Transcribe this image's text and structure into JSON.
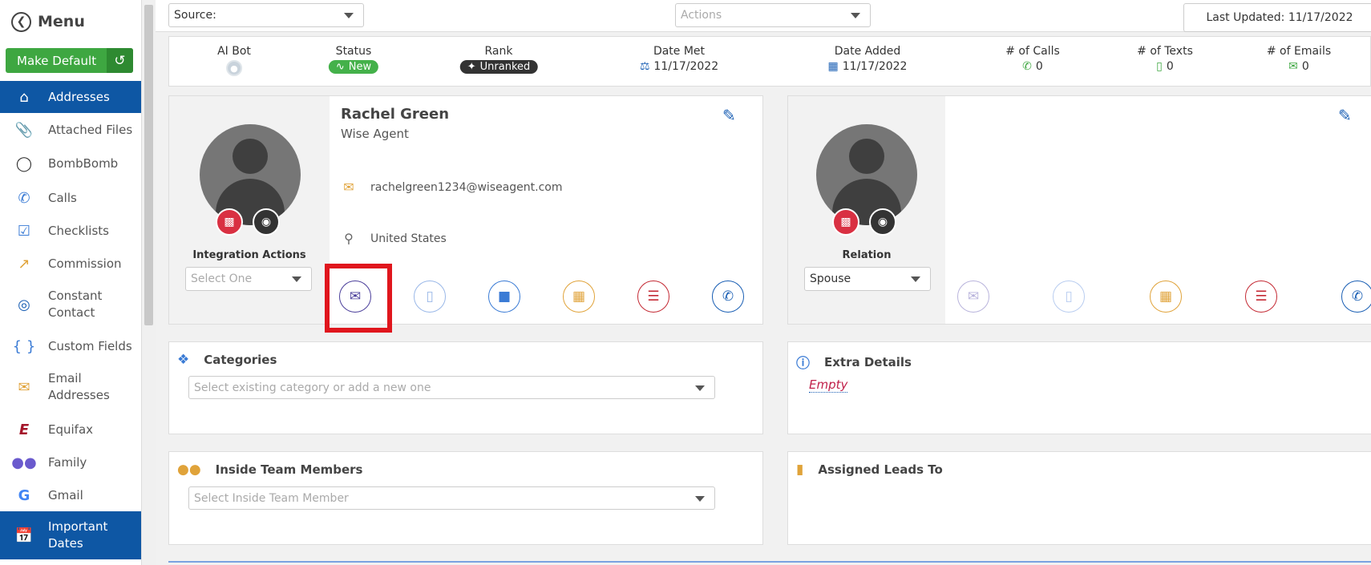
{
  "sidebar": {
    "menu_label": "Menu",
    "make_default_label": "Make Default",
    "items": [
      {
        "label": "Addresses",
        "icon": "home-icon",
        "active": true
      },
      {
        "label": "Attached Files",
        "icon": "paperclip-icon"
      },
      {
        "label": "BombBomb",
        "icon": "bombbomb-icon"
      },
      {
        "label": "Calls",
        "icon": "phone-icon"
      },
      {
        "label": "Checklists",
        "icon": "checkbox-icon"
      },
      {
        "label": "Commission",
        "icon": "chart-icon"
      },
      {
        "label": "Constant Contact",
        "icon": "constant-contact-icon"
      },
      {
        "label": "Custom Fields",
        "icon": "braces-icon"
      },
      {
        "label": "Email Addresses",
        "icon": "envelope-open-icon"
      },
      {
        "label": "Equifax",
        "icon": "equifax-icon"
      },
      {
        "label": "Family",
        "icon": "users-icon"
      },
      {
        "label": "Gmail",
        "icon": "google-icon"
      },
      {
        "label": "Important Dates",
        "icon": "calendar-icon",
        "active": true
      }
    ]
  },
  "topbar": {
    "source_label": "Source:",
    "actions_placeholder": "Actions",
    "last_updated": "Last Updated: 11/17/2022"
  },
  "stats": {
    "ai_bot_label": "AI Bot",
    "status_label": "Status",
    "status_value": "New",
    "rank_label": "Rank",
    "rank_value": "Unranked",
    "date_met_label": "Date Met",
    "date_met_value": "11/17/2022",
    "date_added_label": "Date Added",
    "date_added_value": "11/17/2022",
    "calls_label": "# of Calls",
    "calls_value": "0",
    "texts_label": "# of Texts",
    "texts_value": "0",
    "emails_label": "# of Emails",
    "emails_value": "0"
  },
  "contact": {
    "name": "Rachel Green",
    "role": "Wise Agent",
    "email": "rachelgreen1234@wiseagent.com",
    "location": "United States",
    "integration_label": "Integration Actions",
    "integration_placeholder": "Select One"
  },
  "spouse": {
    "relation_label": "Relation",
    "relation_value": "Spouse"
  },
  "categories": {
    "title": "Categories",
    "placeholder": "Select existing category or add a new one"
  },
  "extra": {
    "title": "Extra Details",
    "empty": "Empty"
  },
  "team": {
    "title": "Inside Team Members",
    "placeholder": "Select Inside Team Member"
  },
  "assigned": {
    "title": "Assigned Leads To"
  },
  "colors": {
    "primary": "#0e57a4",
    "green": "#3ea741",
    "red": "#d93042",
    "highlight": "#e0161d"
  }
}
